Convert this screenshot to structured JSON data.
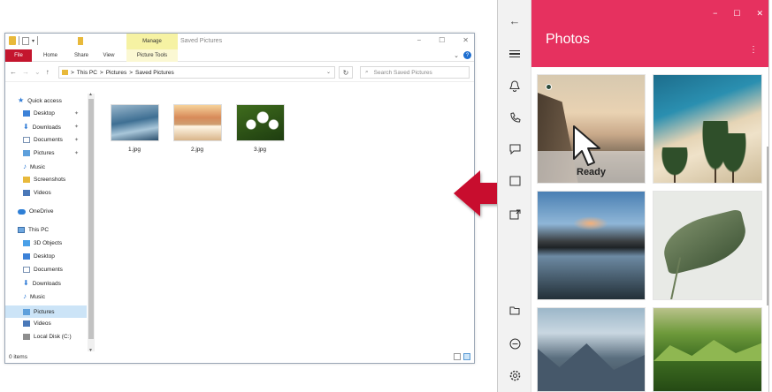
{
  "explorer": {
    "title": "Saved Pictures",
    "manage_tab": "Manage",
    "picture_tools_tab": "Picture Tools",
    "tabs": {
      "file": "File",
      "home": "Home",
      "share": "Share",
      "view": "View"
    },
    "window_controls": {
      "minimize": "−",
      "maximize": "☐",
      "close": "✕"
    },
    "address": {
      "segments": [
        "This PC",
        "Pictures",
        "Saved Pictures"
      ],
      "separator": ">"
    },
    "search_placeholder": "Search Saved Pictures",
    "sidebar": {
      "quick_access": "Quick access",
      "quick_items": [
        "Desktop",
        "Downloads",
        "Documents",
        "Pictures",
        "Music",
        "Screenshots",
        "Videos"
      ],
      "onedrive": "OneDrive",
      "this_pc": "This PC",
      "pc_items": [
        "3D Objects",
        "Desktop",
        "Documents",
        "Downloads",
        "Music",
        "Pictures",
        "Videos",
        "Local Disk (C:)"
      ]
    },
    "files": [
      "1.jpg",
      "2.jpg",
      "3.jpg"
    ],
    "status": "0 items"
  },
  "photos": {
    "title": "Photos",
    "more_glyph": "⋮",
    "ready_label": "Ready",
    "window_controls": {
      "minimize": "−",
      "maximize": "☐",
      "close": "✕"
    },
    "rail_icons": [
      "back-arrow-icon",
      "menu-icon",
      "bell-icon",
      "phone-icon",
      "chat-icon",
      "screen-share-icon",
      "folder-icon",
      "minus-circle-icon",
      "settings-icon"
    ],
    "accent_color": "#e6315f"
  },
  "arrow_color": "#c8102e"
}
